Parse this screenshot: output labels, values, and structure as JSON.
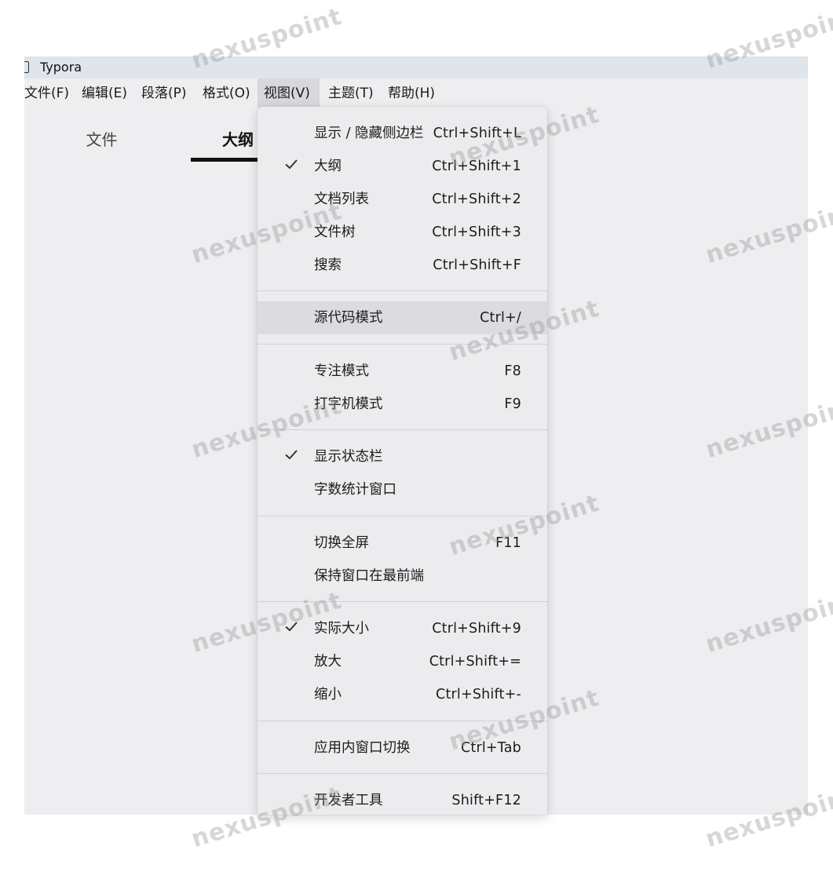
{
  "window": {
    "title": "Typora"
  },
  "menu_bar": {
    "items": [
      {
        "label": "文件(F)"
      },
      {
        "label": "编辑(E)"
      },
      {
        "label": "段落(P)"
      },
      {
        "label": "格式(O)"
      },
      {
        "label": "视图(V)",
        "active": true
      },
      {
        "label": "主题(T)"
      },
      {
        "label": "帮助(H)"
      }
    ]
  },
  "sidebar": {
    "tabs": [
      {
        "label": "文件"
      },
      {
        "label": "大纲",
        "active": true
      }
    ]
  },
  "view_menu": {
    "items": [
      {
        "label": "显示 / 隐藏侧边栏",
        "shortcut": "Ctrl+Shift+L",
        "checked": false
      },
      {
        "label": "大纲",
        "shortcut": "Ctrl+Shift+1",
        "checked": true
      },
      {
        "label": "文档列表",
        "shortcut": "Ctrl+Shift+2",
        "checked": false
      },
      {
        "label": "文件树",
        "shortcut": "Ctrl+Shift+3",
        "checked": false
      },
      {
        "label": "搜索",
        "shortcut": "Ctrl+Shift+F",
        "checked": false
      },
      {
        "label": "源代码模式",
        "shortcut": "Ctrl+/",
        "checked": false,
        "highlighted": true
      },
      {
        "label": "专注模式",
        "shortcut": "F8",
        "checked": false
      },
      {
        "label": "打字机模式",
        "shortcut": "F9",
        "checked": false
      },
      {
        "label": "显示状态栏",
        "shortcut": "",
        "checked": true
      },
      {
        "label": "字数统计窗口",
        "shortcut": "",
        "checked": false
      },
      {
        "label": "切换全屏",
        "shortcut": "F11",
        "checked": false
      },
      {
        "label": "保持窗口在最前端",
        "shortcut": "",
        "checked": false
      },
      {
        "label": "实际大小",
        "shortcut": "Ctrl+Shift+9",
        "checked": true
      },
      {
        "label": "放大",
        "shortcut": "Ctrl+Shift+=",
        "checked": false
      },
      {
        "label": "缩小",
        "shortcut": "Ctrl+Shift+-",
        "checked": false
      },
      {
        "label": "应用内窗口切换",
        "shortcut": "Ctrl+Tab",
        "checked": false
      },
      {
        "label": "开发者工具",
        "shortcut": "Shift+F12",
        "checked": false
      }
    ]
  },
  "watermark": {
    "text": "nexuspoint"
  },
  "colors": {
    "window_bg": "#eeeef1",
    "title_bar_bg": "#dfe5ea",
    "menu_bg": "#ececef",
    "highlight_bg": "#dcdce0",
    "separator": "#cdd3da"
  }
}
